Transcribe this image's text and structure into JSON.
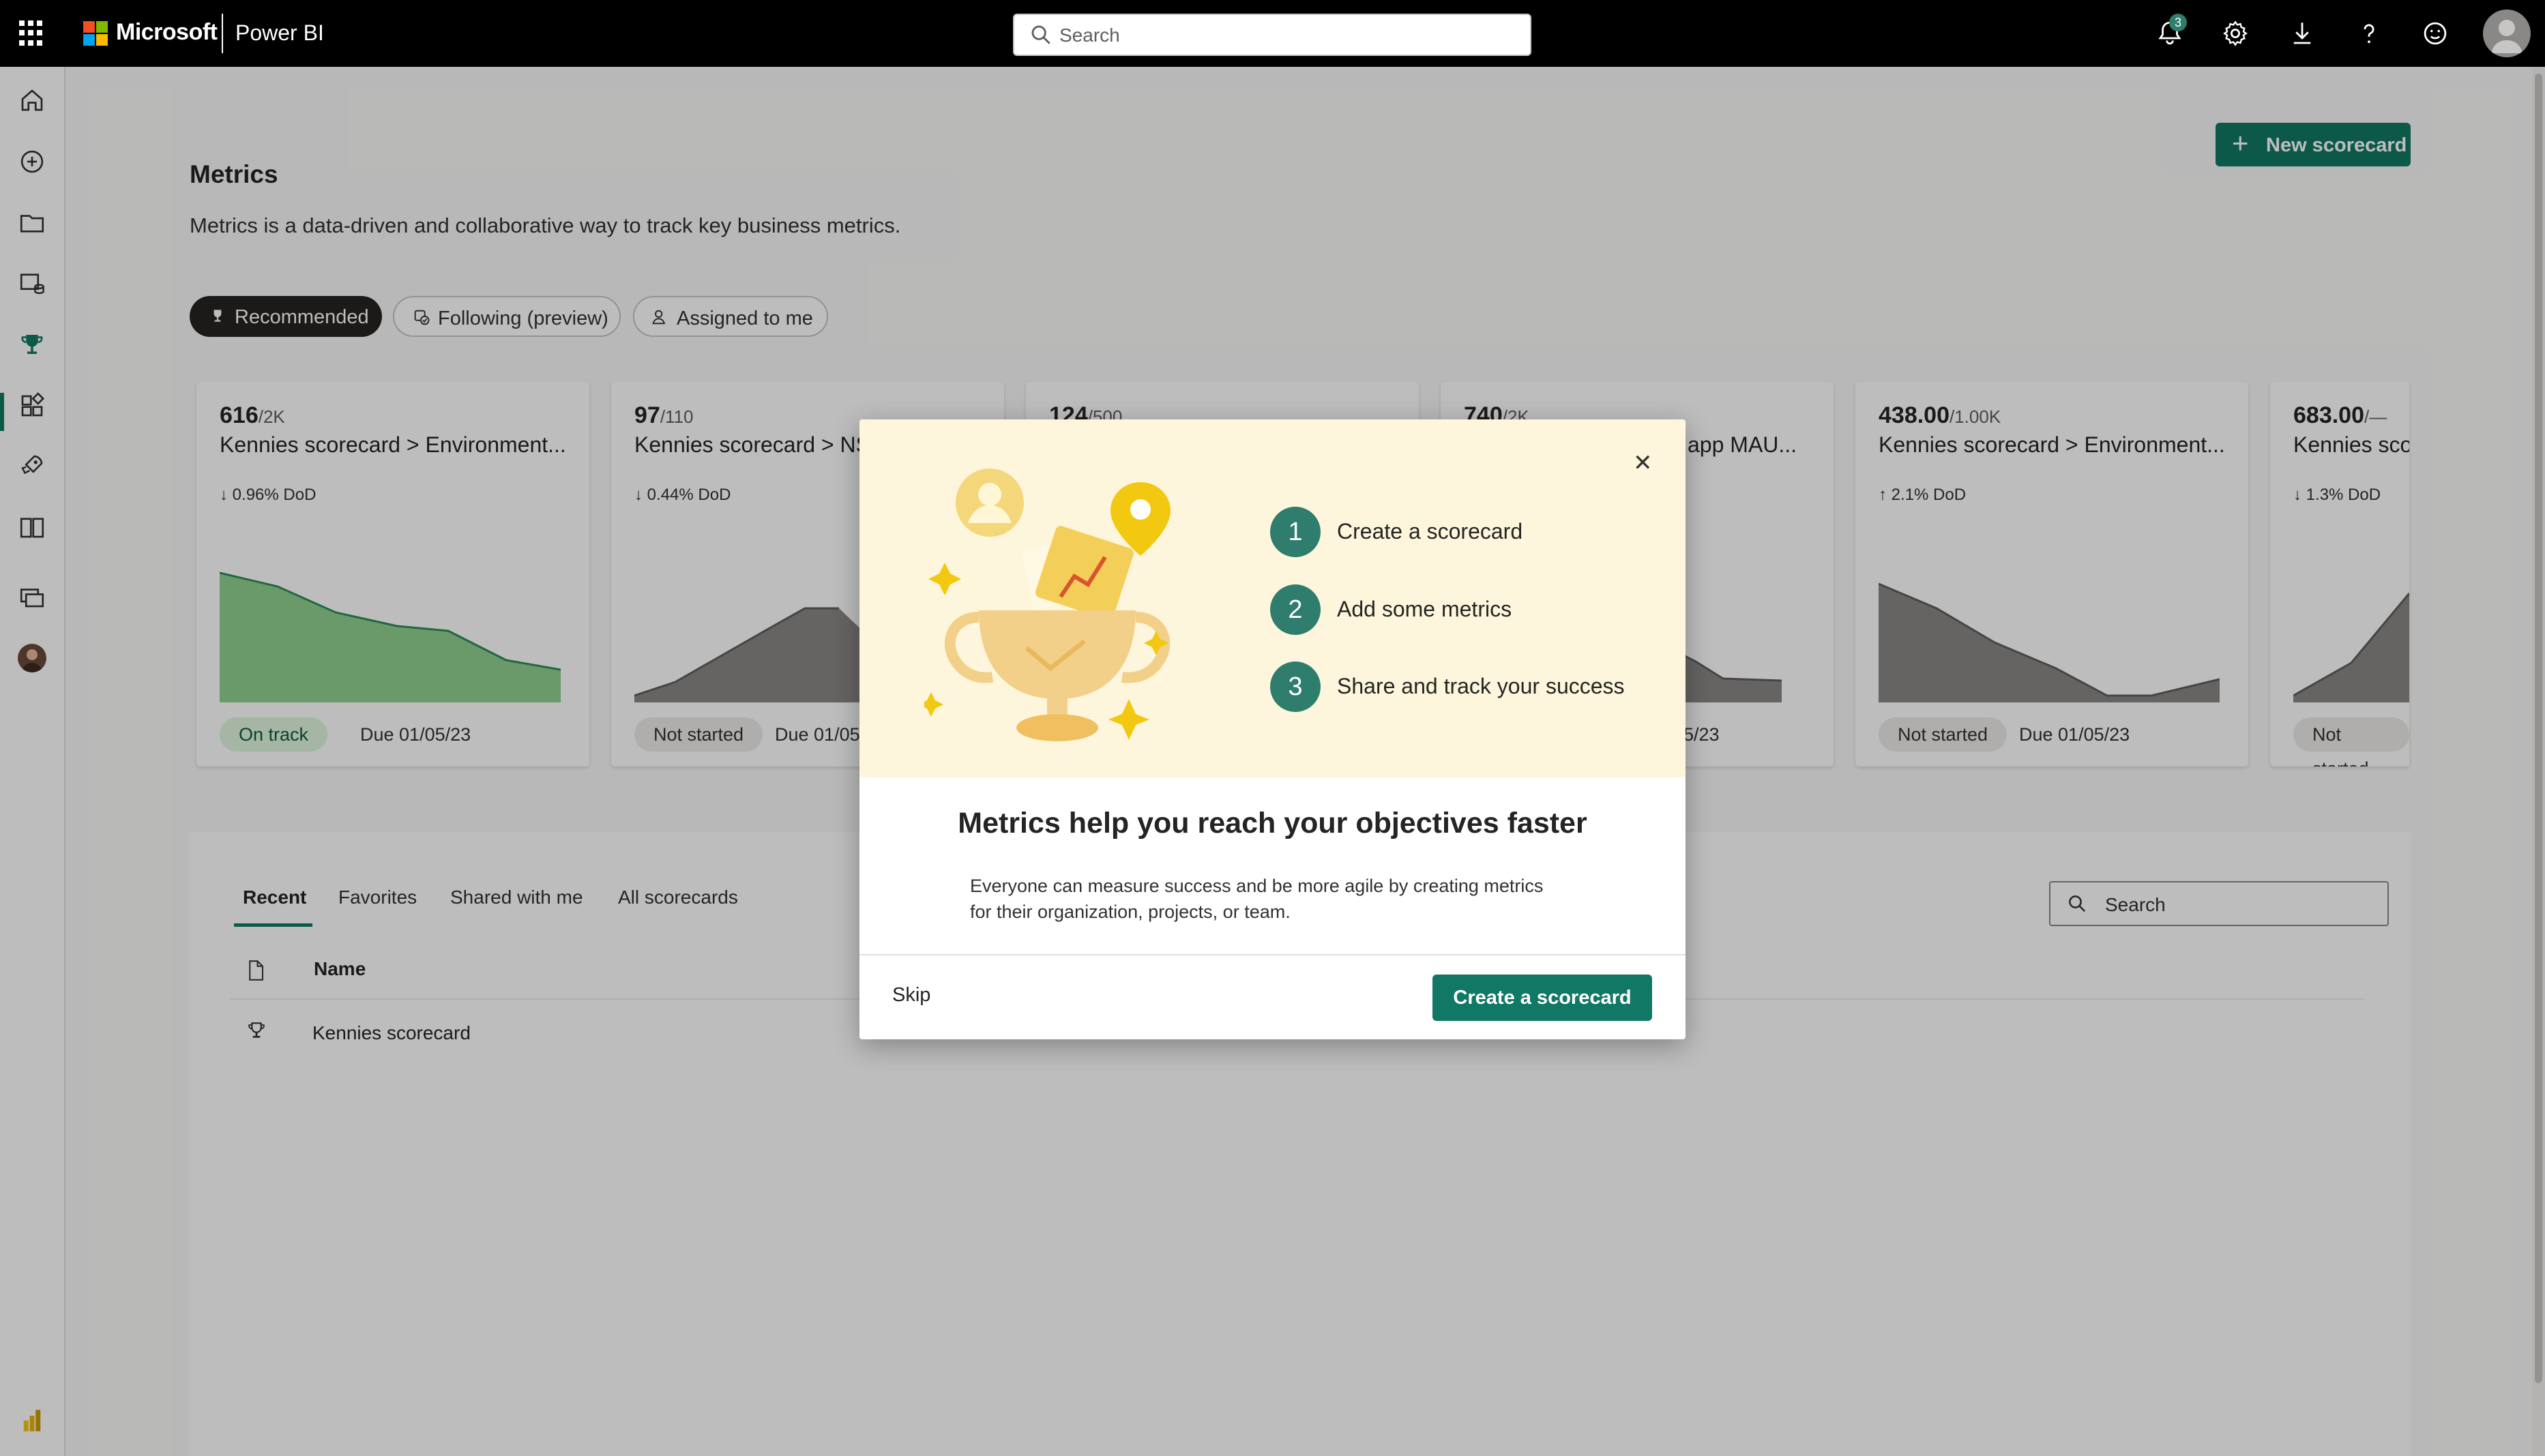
{
  "topbar": {
    "brand_company": "Microsoft",
    "brand_app": "Power BI",
    "search_placeholder": "Search",
    "notification_count": "3",
    "icons": [
      "bell-icon",
      "gear-icon",
      "download-icon",
      "help-icon",
      "feedback-icon",
      "account-icon"
    ]
  },
  "sidebar": {
    "items": [
      "home-icon",
      "create-icon",
      "browse-icon",
      "datahub-icon",
      "metrics-icon",
      "apps-icon",
      "deployment-icon",
      "learn-icon",
      "workspaces-icon",
      "my-workspace-icon"
    ]
  },
  "page": {
    "title": "Metrics",
    "description": "Metrics is a data-driven and collaborative way to track key business metrics.",
    "new_scorecard": "New scorecard"
  },
  "filters": [
    "Recommended",
    "Following (preview)",
    "Assigned to me"
  ],
  "cards": [
    {
      "value": "616",
      "target": "/2K",
      "name": "Kennies scorecard > Environment...",
      "delta": "0.96% DoD",
      "direction": "down",
      "status": "On track",
      "due": "Due 01/05/23"
    },
    {
      "value": "97",
      "target": "/110",
      "name": "Kennies scorecard > NS",
      "delta": "0.44% DoD",
      "direction": "down",
      "status": "Not started",
      "due": "Due 01/05"
    },
    {
      "value": "124",
      "target": "/500",
      "name": "",
      "delta": "",
      "direction": "",
      "status": "",
      "due": ""
    },
    {
      "value": "740",
      "target": "/2K",
      "name": "l app MAU...",
      "delta": "",
      "direction": "",
      "status": "",
      "due": "5/23"
    },
    {
      "value": "438.00",
      "target": "/1.00K",
      "name": "Kennies scorecard > Environment...",
      "delta": "2.1% DoD",
      "direction": "up",
      "status": "Not started",
      "due": "Due 01/05/23"
    },
    {
      "value": "683.00",
      "target": "/—",
      "name": "Kennies scor",
      "delta": "1.3% DoD",
      "direction": "down",
      "status": "Not started",
      "due": ""
    }
  ],
  "list": {
    "tabs": [
      "Recent",
      "Favorites",
      "Shared with me",
      "All scorecards"
    ],
    "active_tab": "Recent",
    "search_placeholder": "Search",
    "column_name": "Name",
    "rows": [
      {
        "name": "Kennies scorecard"
      }
    ]
  },
  "modal": {
    "steps": [
      {
        "num": "1",
        "label": "Create a scorecard"
      },
      {
        "num": "2",
        "label": "Add some metrics"
      },
      {
        "num": "3",
        "label": "Share and track your success"
      }
    ],
    "title": "Metrics help you reach your objectives faster",
    "body_line1": "Everyone can measure success and be more agile by creating metrics",
    "body_line2": "for their organization, projects, or team.",
    "skip": "Skip",
    "create": "Create a scorecard"
  },
  "colors": {
    "accent": "#117865",
    "step": "#2f7d6d",
    "hero": "#fdf6dc",
    "ontrack_fill": "#8fd08f"
  }
}
